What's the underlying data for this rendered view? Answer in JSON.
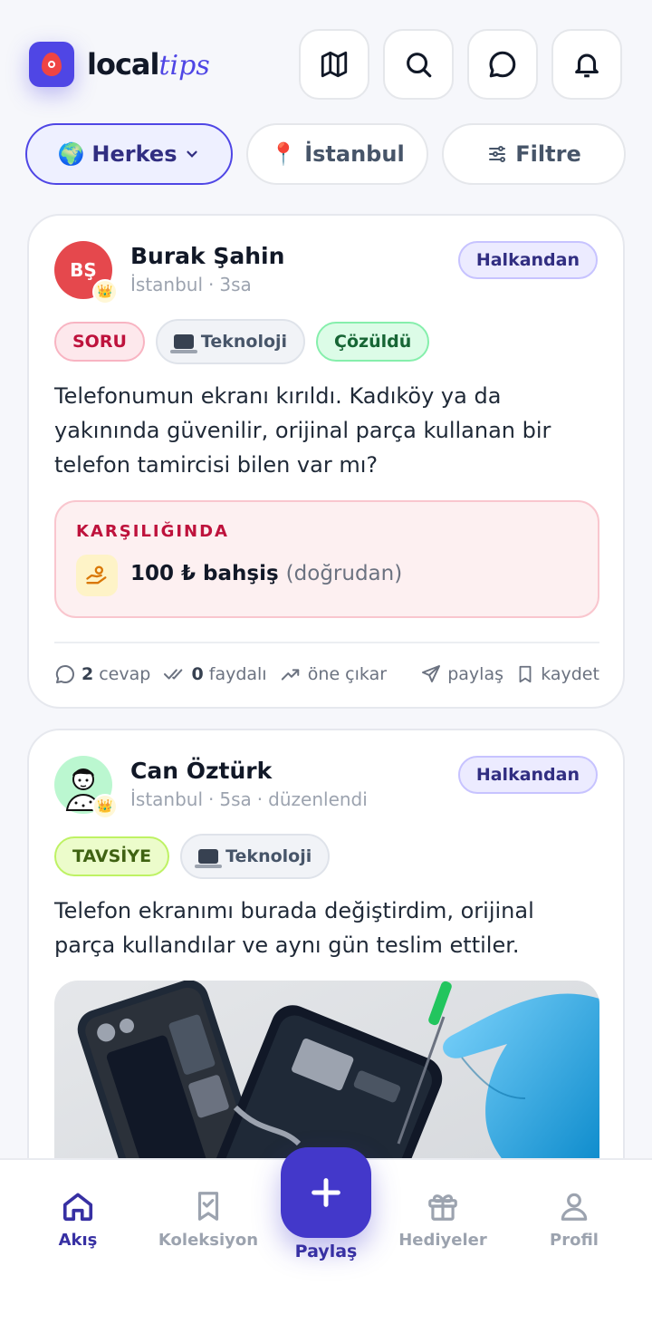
{
  "header": {
    "logo_part1": "local",
    "logo_part2": "tips",
    "icons": [
      "map-icon",
      "search-icon",
      "chat-icon",
      "bell-icon"
    ]
  },
  "filters": {
    "audience": "Herkes",
    "audience_emoji": "🌍",
    "location": "İstanbul",
    "location_emoji": "📍",
    "filter_label": "Filtre"
  },
  "posts": [
    {
      "author_initials": "BŞ",
      "author_name": "Burak Şahin",
      "city": "İstanbul",
      "time": "3sa",
      "edited": "",
      "scope": "Halkandan",
      "tags": [
        "SORU",
        "Teknoloji",
        "Çözüldü"
      ],
      "text": "Telefonumun ekranı kırıldı. Kadıköy ya da yakınında güvenilir, orijinal parça kullanan bir telefon tamircisi bilen var mı?",
      "reward": {
        "title": "KARŞILIĞINDA",
        "value": "100 ₺ bahşiş",
        "note": "(doğrudan)"
      },
      "actions": {
        "answers_count": "2",
        "answers_label": "cevap",
        "useful_count": "0",
        "useful_label": "faydalı",
        "promote": "öne çıkar",
        "share": "paylaş",
        "save": "kaydet"
      }
    },
    {
      "author_name": "Can Öztürk",
      "city": "İstanbul",
      "time": "5sa",
      "edited": "düzenlendi",
      "scope": "Halkandan",
      "tags": [
        "TAVSİYE",
        "Teknoloji"
      ],
      "text": "Telefon ekranımı burada değiştirdim, orijinal parça kullandılar ve aynı gün teslim ettiler."
    }
  ],
  "nav": {
    "feed": "Akış",
    "collection": "Koleksiyon",
    "share": "Paylaş",
    "gifts": "Hediyeler",
    "profile": "Profil"
  },
  "colors": {
    "accent": "#4f46e5",
    "accent_dark": "#3730a3",
    "background": "#f6f7fb"
  }
}
